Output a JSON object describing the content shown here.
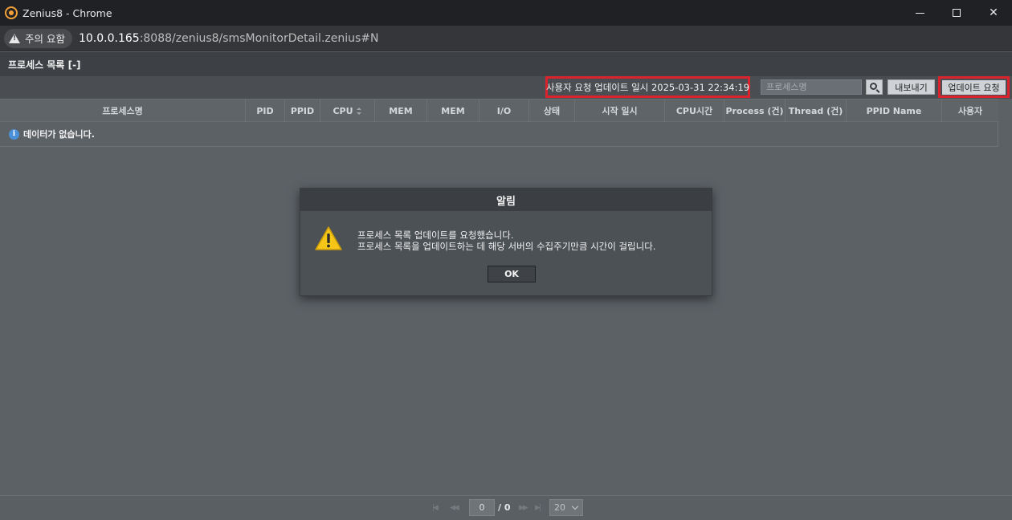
{
  "window": {
    "title": "Zenius8 - Chrome",
    "controls": {
      "minimize": "minimize",
      "maximize": "maximize",
      "close": "✕"
    }
  },
  "address": {
    "security_label": "주의 요함",
    "url_host": "10.0.0.165",
    "url_path": ":8088/zenius8/smsMonitorDetail.zenius#N"
  },
  "panel": {
    "title": "프로세스 목록 [-]"
  },
  "toolbar": {
    "update_time_label": "사용자 요청 업데이트 일시 2025-03-31 22:34:19",
    "search_placeholder": "프로세스명",
    "export_label": "내보내기",
    "request_update_label": "업데이트 요청"
  },
  "table": {
    "columns": [
      "프로세스명",
      "PID",
      "PPID",
      "CPU",
      "MEM",
      "MEM",
      "I/O",
      "상태",
      "시작 일시",
      "CPU시간",
      "Process (건)",
      "Thread (건)",
      "PPID Name",
      "사용자"
    ],
    "empty_message": "데이터가 없습니다."
  },
  "pager": {
    "current_page": "0",
    "total_pages": "/ 0",
    "page_size": "20"
  },
  "modal": {
    "title": "알림",
    "message_line1": "프로세스 목록 업데이트를 요청했습니다.",
    "message_line2": "프로세스 목록을 업데이트하는 데 해당 서버의 수집주기만큼 시간이 걸립니다.",
    "ok_label": "OK"
  },
  "colors": {
    "highlight_border": "#d9232d",
    "warning_icon": "#f5c518",
    "info_icon": "#4a90d9"
  }
}
